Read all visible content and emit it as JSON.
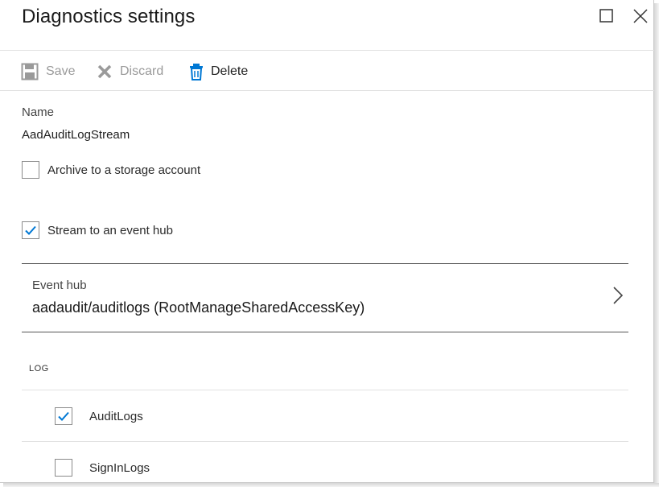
{
  "header": {
    "title": "Diagnostics settings"
  },
  "toolbar": {
    "save_label": "Save",
    "discard_label": "Discard",
    "delete_label": "Delete"
  },
  "form": {
    "name_label": "Name",
    "name_value": "AadAuditLogStream",
    "archive": {
      "label": "Archive to a storage account",
      "checked": false
    },
    "stream": {
      "label": "Stream to an event hub",
      "checked": true
    },
    "event_hub": {
      "label": "Event hub",
      "value": "aadaudit/auditlogs (RootManageSharedAccessKey)"
    }
  },
  "logs": {
    "heading": "LOG",
    "items": [
      {
        "label": "AuditLogs",
        "checked": true
      },
      {
        "label": "SignInLogs",
        "checked": false
      }
    ]
  },
  "colors": {
    "accent": "#0078d4",
    "disabled": "#9a9a9a"
  }
}
